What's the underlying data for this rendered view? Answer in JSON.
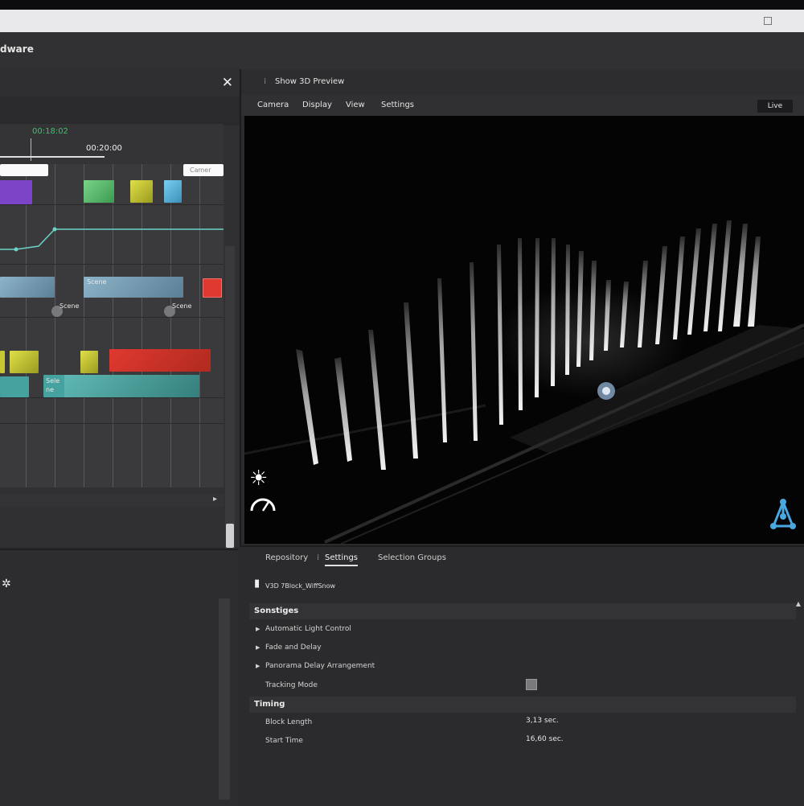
{
  "app": {
    "title_fragment": "dware"
  },
  "left_panel": {
    "close_icon": "close-icon",
    "timeline": {
      "timecode_current": "00:18:02",
      "timecode_end": "00:20:00",
      "scene_labels": [
        "Scene",
        "Scene",
        "Scene",
        "Sele ne"
      ],
      "input_right": "Camer"
    }
  },
  "preview": {
    "title": "Show 3D Preview",
    "menu": [
      "Camera",
      "Display",
      "View",
      "Settings"
    ],
    "live_label": "Live",
    "icons": [
      "sun-icon",
      "gauge-icon",
      "network-icon"
    ]
  },
  "bottom_panel": {
    "tabs": [
      "Repository",
      "Settings",
      "Selection Groups"
    ],
    "active_tab": "Settings",
    "selected_object": "V3D 7Block_WiffSnow",
    "sections": [
      {
        "title": "Sonstiges",
        "items": [
          {
            "label": "Automatic Light Control",
            "expandable": true
          },
          {
            "label": "Fade and Delay",
            "expandable": true
          },
          {
            "label": "Panorama Delay Arrangement",
            "expandable": true
          },
          {
            "label": "Tracking Mode",
            "expandable": false,
            "checkbox": false
          }
        ]
      },
      {
        "title": "Timing",
        "items": [
          {
            "label": "Block Length",
            "value": "3,13 sec."
          },
          {
            "label": "Start Time",
            "value": "16,60 sec."
          }
        ]
      }
    ]
  },
  "colors": {
    "green_block": "#5fbf70",
    "yellow_block": "#c8c832",
    "cyan_block": "#4aaed8",
    "purple_block": "#7c45c8",
    "red_block": "#e0392f",
    "teal_block": "#45a29e",
    "steel_block": "#6b8fa8"
  }
}
